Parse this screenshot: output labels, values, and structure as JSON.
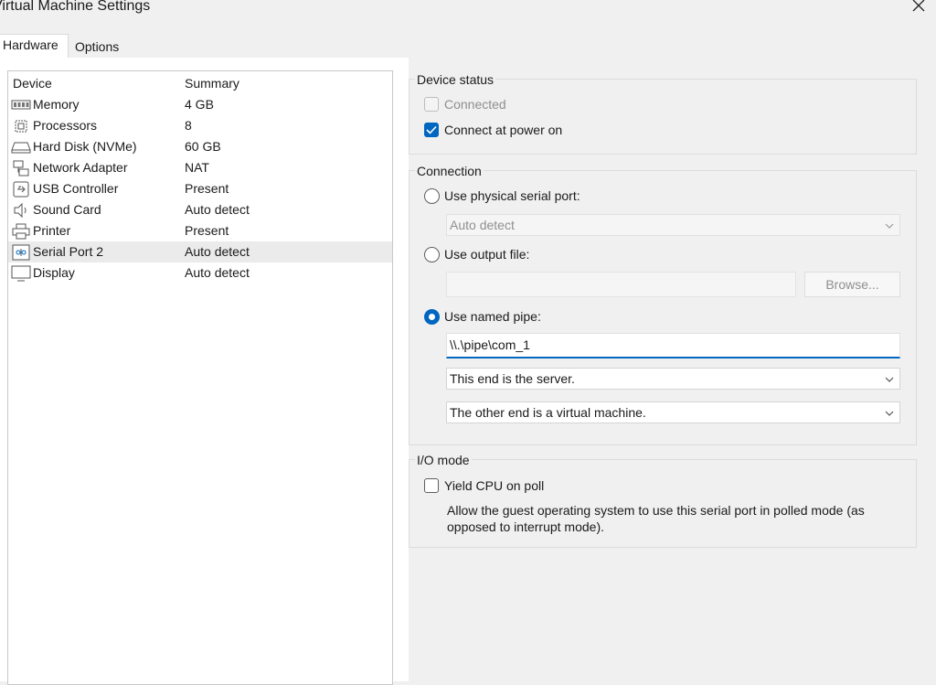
{
  "window": {
    "title": "Virtual Machine Settings",
    "close_icon": "close-icon"
  },
  "tabs": [
    {
      "label": "Hardware",
      "active": true
    },
    {
      "label": "Options",
      "active": false
    }
  ],
  "device_list": {
    "headers": {
      "device": "Device",
      "summary": "Summary"
    },
    "items": [
      {
        "name": "Memory",
        "summary": "4 GB",
        "icon": "memory-icon"
      },
      {
        "name": "Processors",
        "summary": "8",
        "icon": "processor-icon"
      },
      {
        "name": "Hard Disk (NVMe)",
        "summary": "60 GB",
        "icon": "hard-disk-icon"
      },
      {
        "name": "Network Adapter",
        "summary": "NAT",
        "icon": "network-adapter-icon"
      },
      {
        "name": "USB Controller",
        "summary": "Present",
        "icon": "usb-icon"
      },
      {
        "name": "Sound Card",
        "summary": "Auto detect",
        "icon": "speaker-icon"
      },
      {
        "name": "Printer",
        "summary": "Present",
        "icon": "printer-icon"
      },
      {
        "name": "Serial Port 2",
        "summary": "Auto detect",
        "icon": "serial-port-icon",
        "selected": true
      },
      {
        "name": "Display",
        "summary": "Auto detect",
        "icon": "display-icon"
      }
    ]
  },
  "device_status": {
    "title": "Device status",
    "connected": {
      "label": "Connected",
      "checked": false,
      "enabled": false
    },
    "connect_power": {
      "label": "Connect at power on",
      "checked": true
    }
  },
  "connection": {
    "title": "Connection",
    "physical": {
      "label": "Use physical serial port:",
      "selected": false
    },
    "physical_combo": "Auto detect",
    "output_file": {
      "label": "Use output file:",
      "selected": false
    },
    "output_file_value": "",
    "browse_label": "Browse...",
    "named_pipe": {
      "label": "Use named pipe:",
      "selected": true
    },
    "pipe_value": "\\\\.\\pipe\\com_1",
    "end_combo": "This end is the server.",
    "other_end_combo": "The other end is a virtual machine."
  },
  "io_mode": {
    "title": "I/O mode",
    "yield": {
      "label": "Yield CPU on poll",
      "checked": false
    },
    "description": "Allow the guest operating system to use this serial port in polled mode (as opposed to interrupt mode)."
  },
  "colors": {
    "accent": "#0067c0",
    "selection": "#ebebeb"
  }
}
